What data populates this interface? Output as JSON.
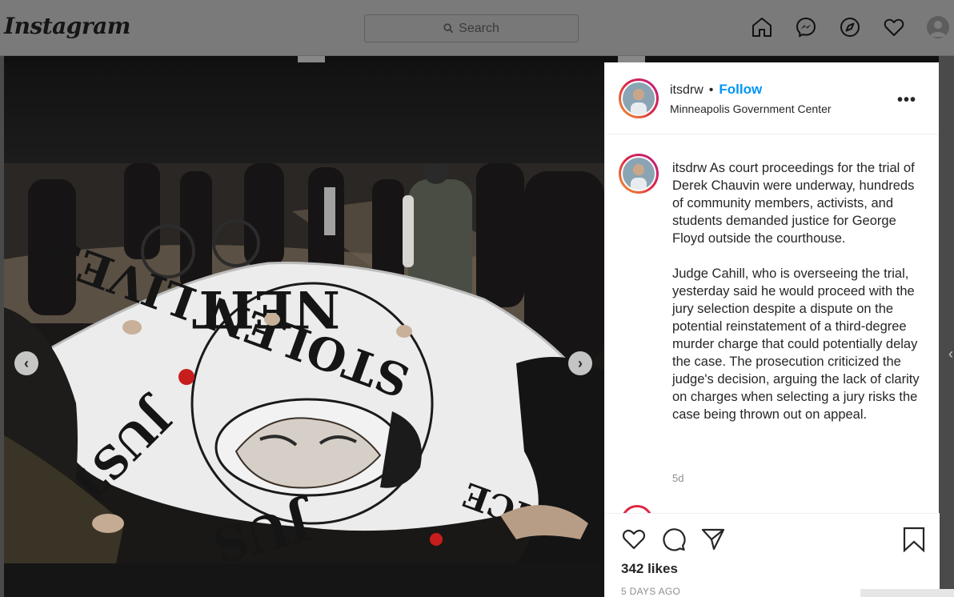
{
  "header": {
    "logo_text": "Instagram",
    "search_placeholder": "Search",
    "nav_icons": [
      "home-icon",
      "messenger-icon",
      "explore-icon",
      "activity-heart-icon",
      "profile-avatar"
    ]
  },
  "post": {
    "username": "itsdrw",
    "separator": "•",
    "follow_label": "Follow",
    "location": "Minneapolis Government Center",
    "more_label": "•••",
    "caption_paragraphs": [
      "As court proceedings for the trial of Derek Chauvin were underway, hundreds of community members, activists, and students demanded justice for George Floyd outside the courthouse.",
      "Judge Cahill, who is overseeing the trial, yesterday said he would proceed with the jury selection despite a dispute on the potential reinstatement of a third-degree murder charge that could potentially delay the case. The prosecution criticized the judge's decision, arguing the lack of clarity on charges when selecting a jury risks the case being thrown out on appeal."
    ],
    "caption_age": "5d",
    "likes": "342 likes",
    "posted_ago": "5 DAYS AGO",
    "carousel": {
      "prev_label": "‹",
      "next_label": "›"
    }
  },
  "colors": {
    "follow_blue": "#0095f6",
    "text": "#262626",
    "muted": "#8e8e8e",
    "story_ring": "#dc2743"
  }
}
